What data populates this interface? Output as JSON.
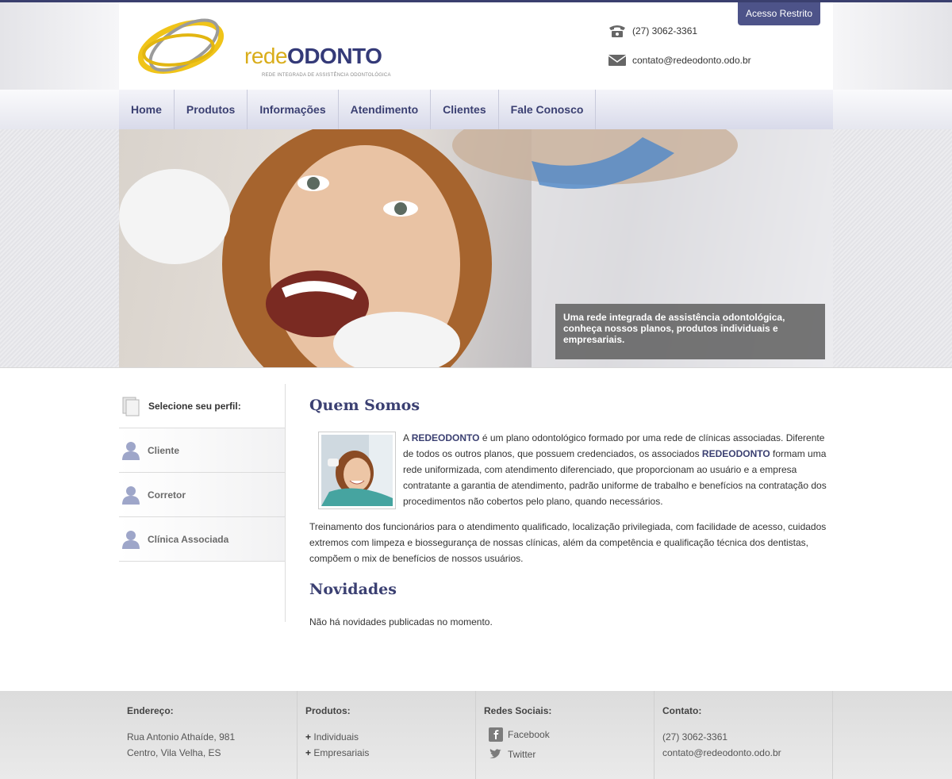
{
  "header": {
    "logo_part1": "rede",
    "logo_part2": "ODONTO",
    "logo_subtitle": "REDE INTEGRADA DE ASSISTÊNCIA ODONTOLÓGICA",
    "restricted_button": "Acesso Restrito",
    "phone": "(27) 3062-3361",
    "email": "contato@redeodonto.odo.br"
  },
  "nav": {
    "items": [
      "Home",
      "Produtos",
      "Informações",
      "Atendimento",
      "Clientes",
      "Fale Conosco"
    ]
  },
  "hero": {
    "caption": "Uma rede integrada de assistência odontológica, conheça nossos planos, produtos individuais e empresariais."
  },
  "sidebar": {
    "title": "Selecione seu perfil:",
    "items": [
      "Cliente",
      "Corretor",
      "Clínica Associada"
    ]
  },
  "main": {
    "about_title": "Quem Somos",
    "about_p1_pre": "A ",
    "about_p1_brand": "REDEODONTO",
    "about_p1_mid": " é um plano odontológico formado por uma rede de clínicas associadas. Diferente de todos os outros planos, que possuem credenciados, os associados ",
    "about_p1_brand2": "REDEODONTO",
    "about_p1_post": " formam uma rede uniformizada, com atendimento diferenciado, que proporcionam ao usuário e a empresa contratante a garantia de atendimento, padrão uniforme de trabalho e benefícios na contratação dos procedimentos não cobertos pelo plano, quando necessários.",
    "about_p2": "Treinamento dos funcionários para o atendimento qualificado, localização privilegiada, com facilidade de acesso, cuidados extremos com limpeza e biossegurança de nossas clínicas, além da competência e qualificação técnica dos dentistas, compõem o mix de benefícios de nossos usuários.",
    "news_title": "Novidades",
    "news_text": "Não há novidades publicadas no momento."
  },
  "footer": {
    "address_title": "Endereço:",
    "address_line1": "Rua Antonio Athaíde, 981",
    "address_line2": "Centro, Vila Velha, ES",
    "products_title": "Produtos:",
    "products": [
      "Individuais",
      "Empresariais"
    ],
    "product_prefix": "+",
    "social_title": "Redes Sociais:",
    "social": [
      "Facebook",
      "Twitter"
    ],
    "contact_title": "Contato:",
    "contact_phone": "(27) 3062-3361",
    "contact_email": "contato@redeodonto.odo.br"
  },
  "colors": {
    "brand_navy": "#3b4072",
    "brand_gold": "#d9ad1a",
    "restricted_bg": "#4d5389"
  }
}
